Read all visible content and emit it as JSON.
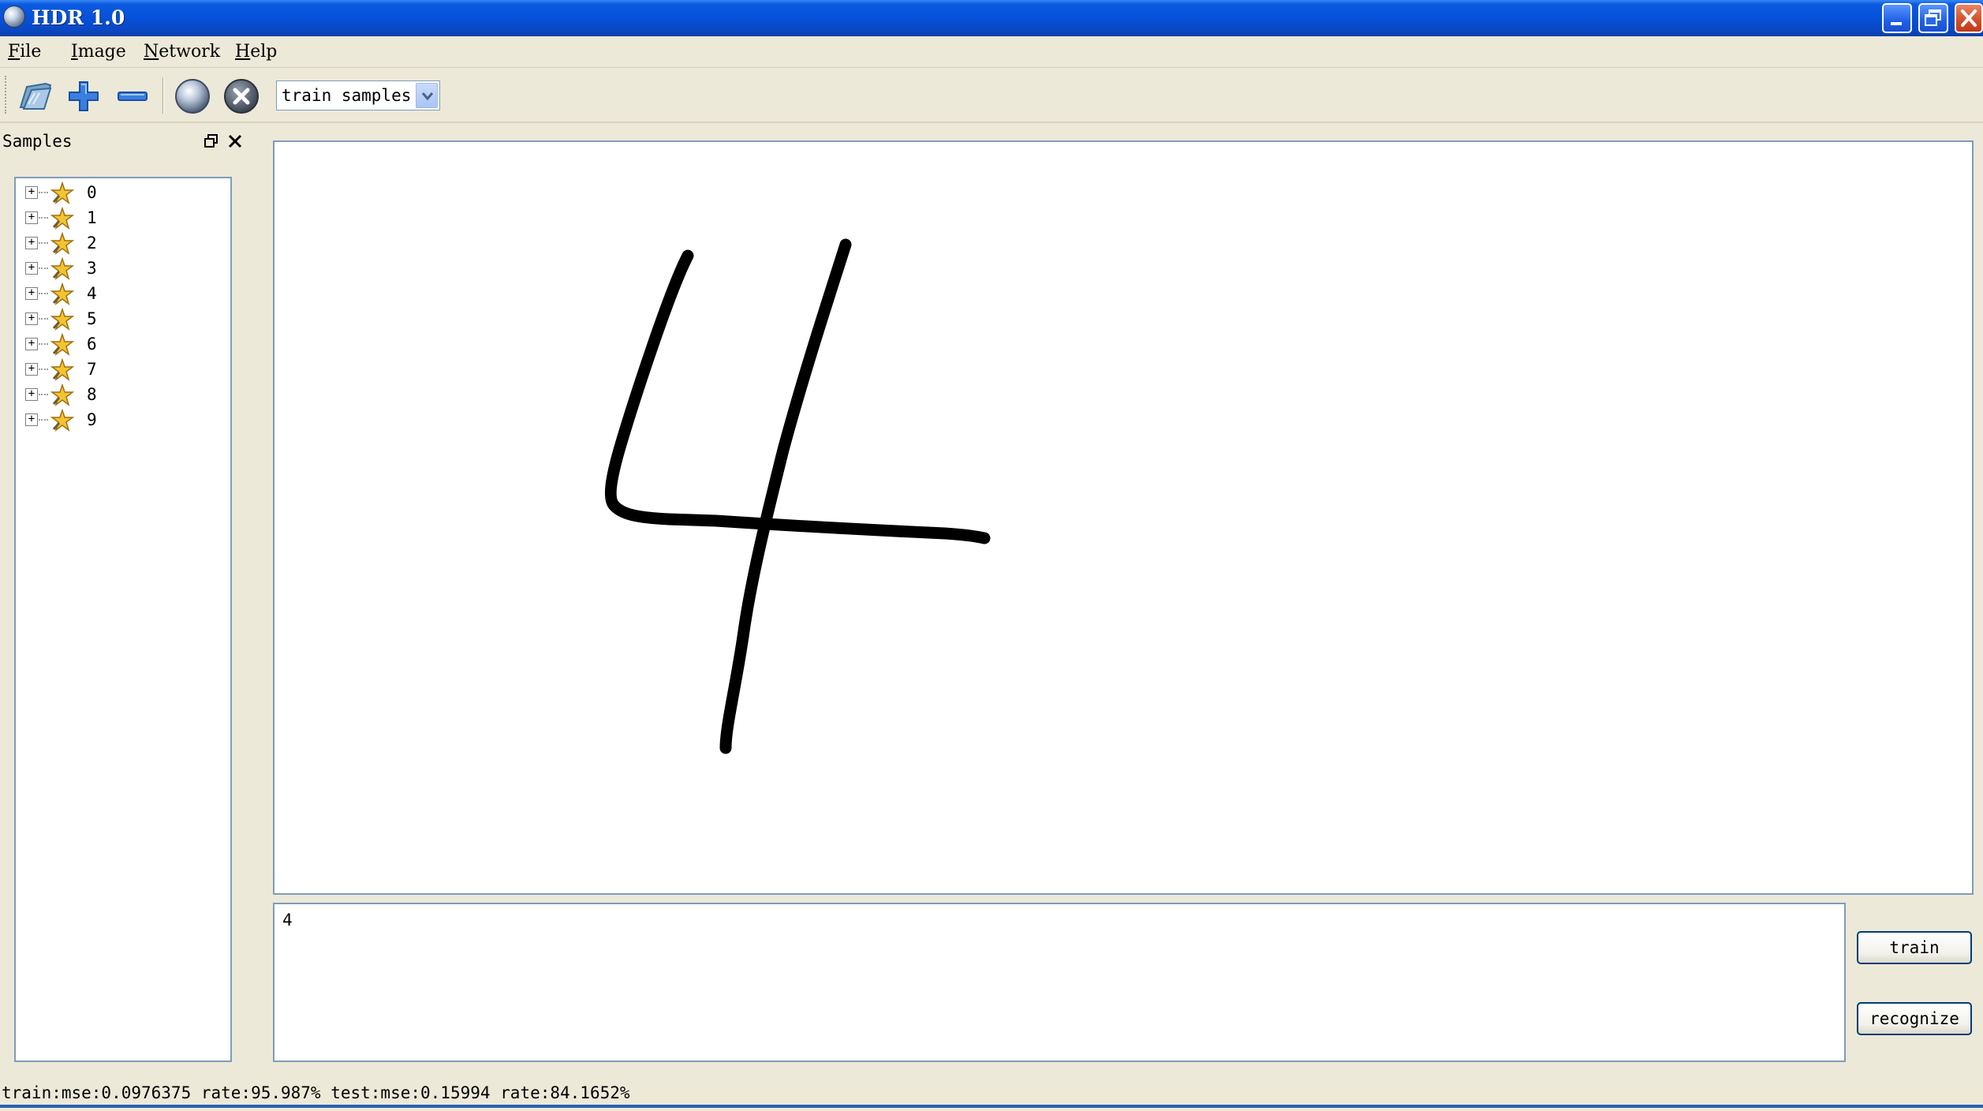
{
  "window": {
    "title": "HDR 1.0",
    "icon": "globe-icon",
    "controls": [
      "minimize-icon",
      "maximize-icon",
      "close-icon"
    ]
  },
  "menu": {
    "items": [
      {
        "label": "File"
      },
      {
        "label": "Image"
      },
      {
        "label": "Network"
      },
      {
        "label": "Help"
      }
    ]
  },
  "toolbar": {
    "buttons": [
      "open-folder-icon",
      "add-icon",
      "remove-icon",
      "network-globe-icon",
      "stop-icon"
    ],
    "mode_select": {
      "value": "train samples"
    }
  },
  "samples_dock": {
    "title": "Samples",
    "items": [
      {
        "label": "0"
      },
      {
        "label": "1"
      },
      {
        "label": "2"
      },
      {
        "label": "3"
      },
      {
        "label": "4"
      },
      {
        "label": "5"
      },
      {
        "label": "6"
      },
      {
        "label": "7"
      },
      {
        "label": "8"
      },
      {
        "label": "9"
      }
    ]
  },
  "result": {
    "text": "4"
  },
  "buttons": {
    "train": "train",
    "recognize": "recognize"
  },
  "status": {
    "text": "train:mse:0.0976375 rate:95.987% test:mse:0.15994 rate:84.1652%"
  },
  "colors": {
    "titlebar": "#0a5ae0",
    "stroke": "#000000",
    "accent_border": "#7f9db9"
  }
}
